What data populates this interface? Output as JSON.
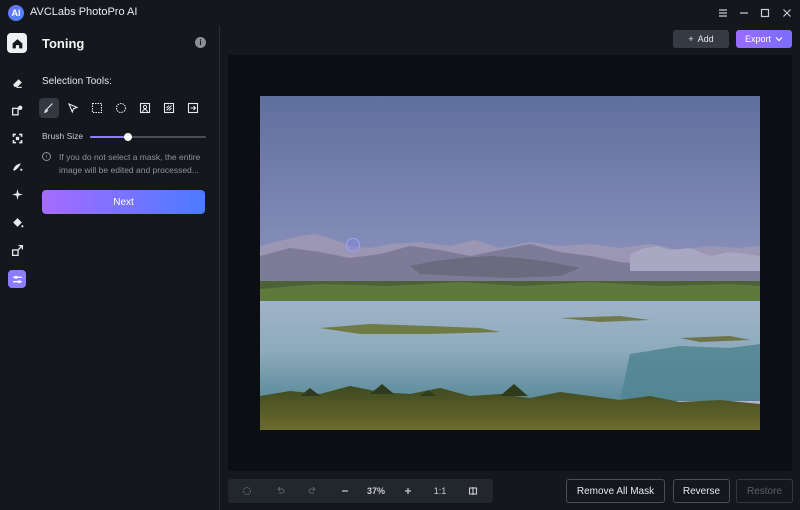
{
  "app": {
    "title": "AVCLabs PhotoPro AI",
    "logo_text": "AI"
  },
  "window_controls": [
    "menu-icon",
    "minimize-icon",
    "maximize-icon",
    "close-icon"
  ],
  "rail": {
    "items": [
      {
        "name": "home",
        "icon": "home-icon"
      },
      {
        "name": "eraser",
        "icon": "eraser-icon"
      },
      {
        "name": "replace",
        "icon": "replace-icon"
      },
      {
        "name": "enhance",
        "icon": "enhance-icon"
      },
      {
        "name": "colorize",
        "icon": "colorize-icon"
      },
      {
        "name": "ai-tools",
        "icon": "sparkle-icon"
      },
      {
        "name": "fill",
        "icon": "fill-icon"
      },
      {
        "name": "resize",
        "icon": "resize-icon"
      },
      {
        "name": "toning",
        "icon": "toning-icon",
        "active": true
      }
    ]
  },
  "panel": {
    "title": "Toning",
    "selection_label": "Selection Tools:",
    "tools": [
      "brush-tool",
      "lasso-tool",
      "rectangle-tool",
      "ellipse-tool",
      "portrait-tool",
      "object-tool",
      "import-mask-tool"
    ],
    "brush_size_label": "Brush Size",
    "brush_size": 0.33,
    "notice": "If you do not select a mask, the entire image will be edited and processed...",
    "next_label": "Next"
  },
  "header_actions": {
    "add_label": "Add",
    "export_label": "Export"
  },
  "zoom": {
    "value": "37%",
    "one_to_one": "1:1"
  },
  "actions": {
    "remove_all_mask": "Remove All Mask",
    "reverse": "Reverse",
    "restore": "Restore"
  },
  "colors": {
    "accent": "#8b7dff",
    "button_gradient_start": "#a66bff",
    "button_gradient_end": "#4b7bff"
  }
}
